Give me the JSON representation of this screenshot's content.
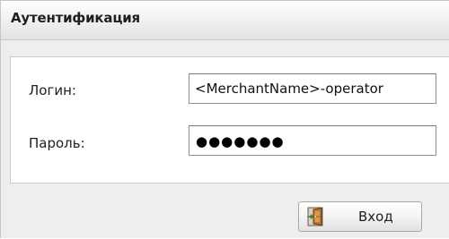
{
  "dialog": {
    "title": "Аутентификация"
  },
  "form": {
    "login": {
      "label": "Логин:",
      "value": "<MerchantName>-operator"
    },
    "password": {
      "label": "Пароль:",
      "masked_value": "●●●●●●●"
    }
  },
  "actions": {
    "login_button": {
      "label": "Вход",
      "icon": "door-enter-icon"
    }
  }
}
